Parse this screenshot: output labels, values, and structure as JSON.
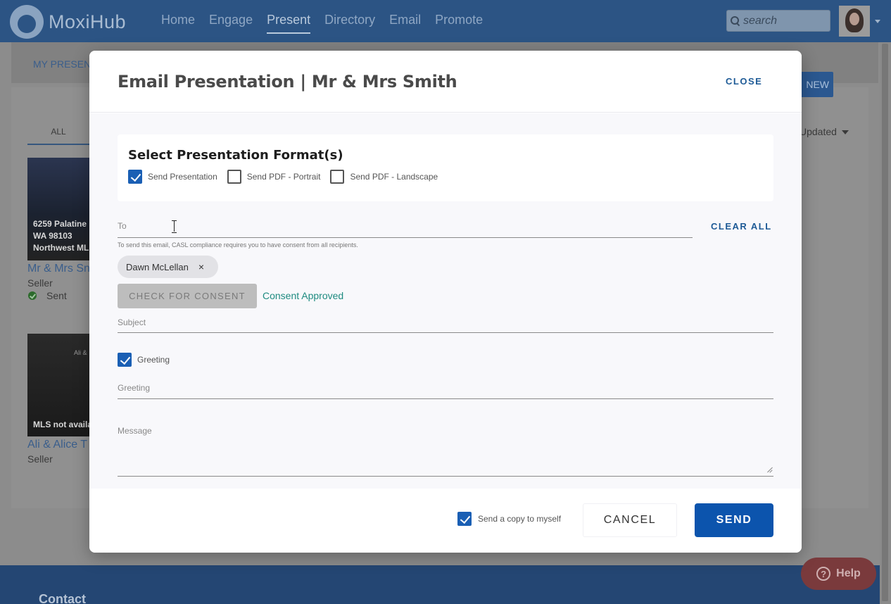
{
  "app": {
    "logo_text": "MoxiHub",
    "nav": [
      "Home",
      "Engage",
      "Present",
      "Directory",
      "Email",
      "Promote"
    ],
    "active_nav": "Present",
    "search_placeholder": "search"
  },
  "background": {
    "subbar_link": "MY PRESEN",
    "new_button": "NEW",
    "tab_all": "ALL",
    "sort_label": "Updated",
    "cards": [
      {
        "image_text": [
          "6259 Palatine",
          "WA 98103",
          "Northwest ML"
        ],
        "title": "Mr & Mrs Sn",
        "role": "Seller",
        "status": "Sent"
      },
      {
        "image_small": "Ali &",
        "image_text": [
          "MLS not availa"
        ],
        "title": "Ali & Alice T",
        "role": "Seller"
      }
    ],
    "footer_text": "Contact",
    "help_label": "Help"
  },
  "modal": {
    "title": "Email Presentation | Mr & Mrs Smith",
    "close_label": "CLOSE",
    "format_title": "Select Presentation Format(s)",
    "formats": [
      {
        "label": "Send Presentation",
        "checked": true
      },
      {
        "label": "Send PDF - Portrait",
        "checked": false
      },
      {
        "label": "Send PDF - Landscape",
        "checked": false
      }
    ],
    "to_label": "To",
    "clear_all_label": "CLEAR ALL",
    "casl_hint": "To send this email, CASL compliance requires you to have consent from all recipients.",
    "recipient": "Dawn McLellan",
    "chip_remove": "×",
    "check_consent_label": "CHECK FOR CONSENT",
    "consent_status": "Consent Approved",
    "subject_label": "Subject",
    "greeting_checkbox_label": "Greeting",
    "greeting_checked": true,
    "greeting_label": "Greeting",
    "message_label": "Message",
    "copy_label": "Send a copy to myself",
    "copy_checked": true,
    "cancel_label": "CANCEL",
    "send_label": "SEND"
  }
}
